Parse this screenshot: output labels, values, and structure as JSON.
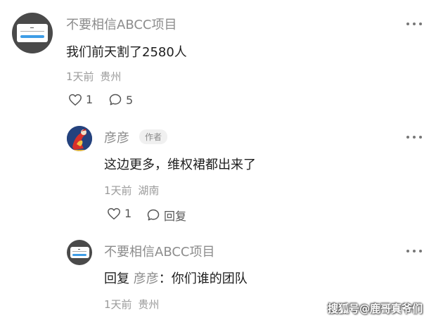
{
  "comment": {
    "author": "不要相信ABCC项目",
    "text": "我们前天割了2580人",
    "time": "1天前",
    "location": "贵州",
    "likes": "1",
    "replies": "5"
  },
  "reply1": {
    "author": "彦彦",
    "badge": "作者",
    "text": "这边更多，维权裙都出来了",
    "time": "1天前",
    "location": "湖南",
    "likes": "1",
    "reply_label": "回复"
  },
  "reply2": {
    "author": "不要相信ABCC项目",
    "prefix": "回复",
    "target": "彦彦",
    "separator": "：",
    "text": "你们谁的团队",
    "time": "1天前",
    "location": "贵州"
  },
  "watermark": "搜狐号@鹿哥真爷们",
  "colors": {
    "name": "#8c8c8c",
    "text": "#1e1e1e",
    "meta": "#9a9a9a",
    "accent_blue": "#3e9de6"
  }
}
